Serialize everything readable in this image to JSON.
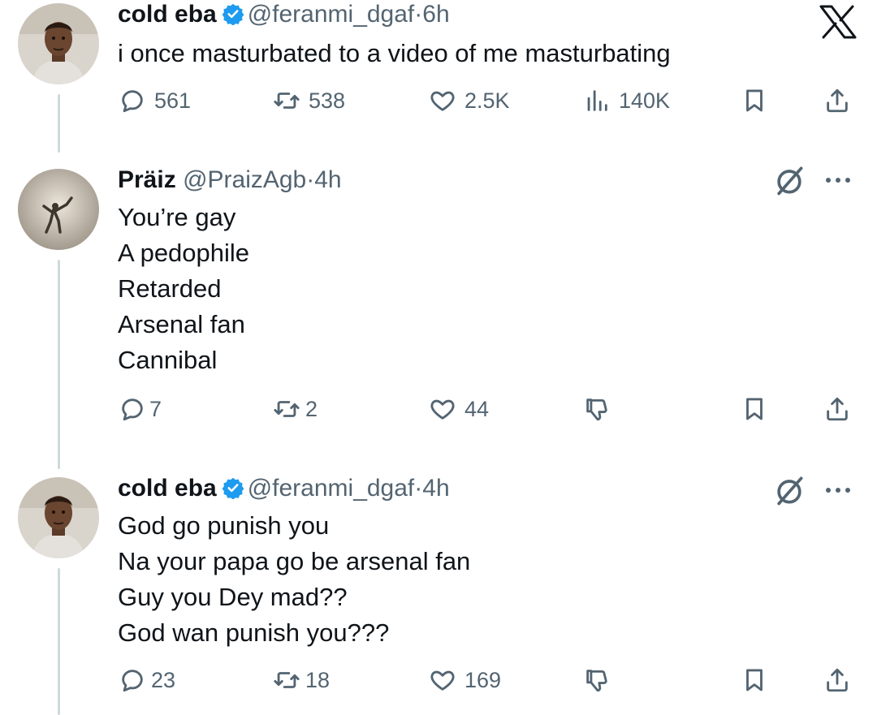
{
  "app": {
    "logo": "x-logo"
  },
  "tweets": [
    {
      "author": {
        "name": "cold eba",
        "handle": "@feranmi_dgaf",
        "verified": true
      },
      "time": "6h",
      "text": [
        "i once masturbated to a video of me masturbating"
      ],
      "stats": {
        "replies": "561",
        "reposts": "538",
        "likes": "2.5K",
        "views": "140K"
      }
    },
    {
      "author": {
        "name": "Präiz",
        "handle": "@PraizAgb",
        "verified": false
      },
      "time": "4h",
      "text": [
        "You’re gay",
        "A pedophile",
        "Retarded",
        "Arsenal fan",
        "Cannibal"
      ],
      "stats": {
        "replies": "7",
        "reposts": "2",
        "likes": "44"
      }
    },
    {
      "author": {
        "name": "cold eba",
        "handle": "@feranmi_dgaf",
        "verified": true
      },
      "time": "4h",
      "text": [
        "God go punish you",
        "Na your papa go be arsenal fan",
        "Guy you Dey mad??",
        "God wan punish you???"
      ],
      "stats": {
        "replies": "23",
        "reposts": "18",
        "likes": "169"
      }
    }
  ],
  "separator": "·",
  "colors": {
    "text": "#0f1419",
    "muted": "#536471",
    "verified": "#1d9bf0",
    "thread_line": "#cfd9de"
  }
}
